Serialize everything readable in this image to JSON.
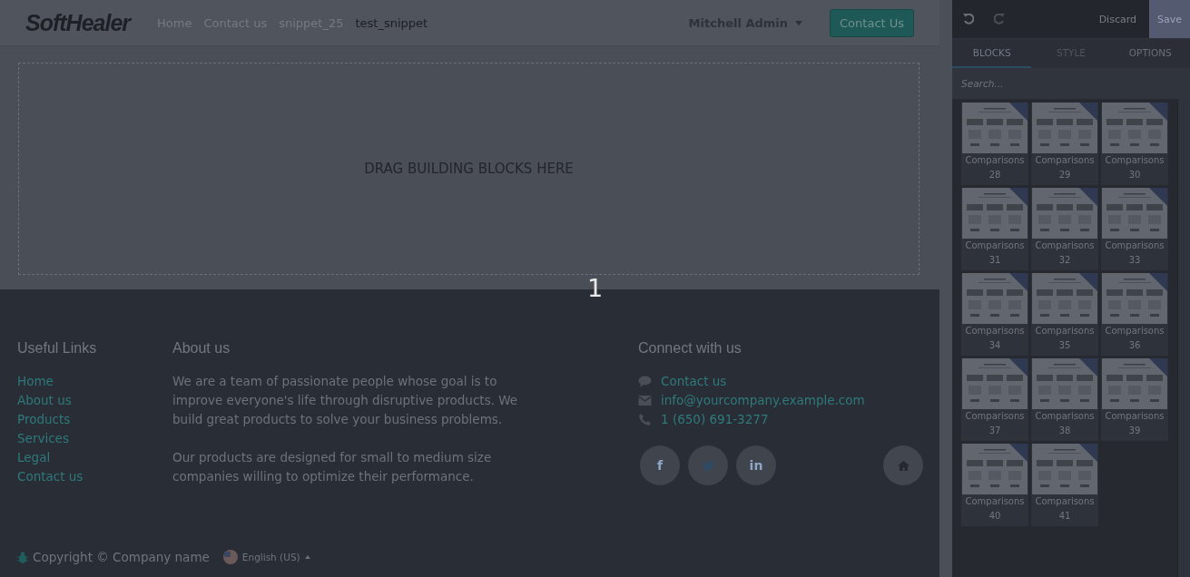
{
  "header": {
    "logo": "SoftHealer",
    "nav": [
      {
        "label": "Home",
        "selected": false
      },
      {
        "label": "Contact us",
        "selected": false
      },
      {
        "label": "snippet_25",
        "selected": false
      },
      {
        "label": "test_snippet",
        "selected": true
      }
    ],
    "user": "Mitchell Admin",
    "cta": "Contact Us"
  },
  "dropzone": {
    "text": "DRAG BUILDING BLOCKS HERE"
  },
  "step_number": "1",
  "footer": {
    "links_title": "Useful Links",
    "links": [
      "Home",
      "About us",
      "Products",
      "Services",
      "Legal",
      "Contact us"
    ],
    "about_title": "About us",
    "about": [
      "We are a team of passionate people whose goal is to improve everyone's life through disruptive products. We build great products to solve your business problems.",
      "Our products are designed for small to medium size companies willing to optimize their performance."
    ],
    "connect_title": "Connect with us",
    "contacts": [
      {
        "kind": "chat",
        "text": "Contact us"
      },
      {
        "kind": "mail",
        "text": "info@yourcompany.example.com"
      },
      {
        "kind": "phone",
        "text": "1 (650) 691-3277"
      }
    ],
    "socials": [
      {
        "kind": "facebook",
        "glyph": "f"
      },
      {
        "kind": "twitter"
      },
      {
        "kind": "linkedin",
        "glyph": "in"
      }
    ],
    "copyright": "Copyright © Company name",
    "language": "English (US)"
  },
  "editor": {
    "discard": "Discard",
    "save": "Save",
    "tabs": [
      {
        "label": "BLOCKS",
        "selected": true,
        "disabled": false
      },
      {
        "label": "STYLE",
        "selected": false,
        "disabled": true
      },
      {
        "label": "OPTIONS",
        "selected": false,
        "disabled": false
      }
    ],
    "search_placeholder": "Search...",
    "blocks": [
      {
        "label": "Comparisons 28"
      },
      {
        "label": "Comparisons 29"
      },
      {
        "label": "Comparisons 30"
      },
      {
        "label": "Comparisons 31"
      },
      {
        "label": "Comparisons 32"
      },
      {
        "label": "Comparisons 33"
      },
      {
        "label": "Comparisons 34"
      },
      {
        "label": "Comparisons 35"
      },
      {
        "label": "Comparisons 36"
      },
      {
        "label": "Comparisons 37"
      },
      {
        "label": "Comparisons 38"
      },
      {
        "label": "Comparisons 39"
      },
      {
        "label": "Comparisons 40"
      },
      {
        "label": "Comparisons 41"
      }
    ]
  }
}
